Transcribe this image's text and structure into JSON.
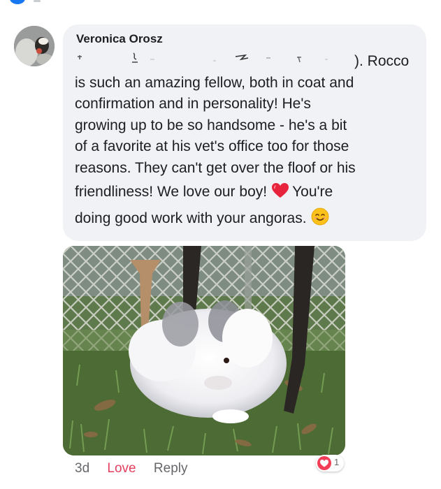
{
  "comment": {
    "author": "Veronica Orosz",
    "lines": [
      "). Rocco",
      "is such an amazing fellow, both in coat and",
      "confirmation and in personality! He's",
      "growing up to be so handsome - he's a bit",
      "of a favorite at his vet's office too for those",
      "reasons. They can't get over the floof or his",
      "friendliness! We love our boy!",
      "You're",
      "doing good work with your angoras."
    ],
    "emoji_heart": "red-heart-icon",
    "emoji_smile": "smiling-face-icon"
  },
  "actions": {
    "time": "3d",
    "love": "Love",
    "reply": "Reply"
  },
  "reaction": {
    "icon": "heart-reaction-icon",
    "count": "1"
  },
  "colors": {
    "bubble": "#f0f2f5",
    "love": "#e4405f",
    "reaction": "#f33e58",
    "muted": "#65676b"
  }
}
